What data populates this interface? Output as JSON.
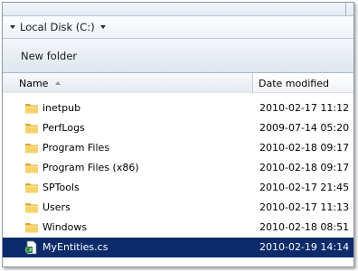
{
  "breadcrumb": {
    "location": "Local Disk (C:)"
  },
  "toolbar": {
    "new_folder_label": "New folder"
  },
  "columns": {
    "name": "Name",
    "date_modified": "Date modified"
  },
  "files": [
    {
      "name": "inetpub",
      "date": "2010-02-17 11:12",
      "type": "folder"
    },
    {
      "name": "PerfLogs",
      "date": "2009-07-14 05:20",
      "type": "folder"
    },
    {
      "name": "Program Files",
      "date": "2010-02-18 09:17",
      "type": "folder"
    },
    {
      "name": "Program Files (x86)",
      "date": "2010-02-18 09:17",
      "type": "folder"
    },
    {
      "name": "SPTools",
      "date": "2010-02-17 21:45",
      "type": "folder"
    },
    {
      "name": "Users",
      "date": "2010-02-17 11:13",
      "type": "folder"
    },
    {
      "name": "Windows",
      "date": "2010-02-18 08:51",
      "type": "folder"
    },
    {
      "name": "MyEntities.cs",
      "date": "2010-02-19 14:14",
      "type": "cs-file",
      "selected": true
    }
  ],
  "colors": {
    "selection": "#0d2a6b",
    "folder": "#f3c94b"
  },
  "icons": {
    "folder": "folder-icon",
    "file": "cs-file-icon",
    "sort": "sort-ascending-icon",
    "breadcrumb": "chevron-down-icon"
  }
}
